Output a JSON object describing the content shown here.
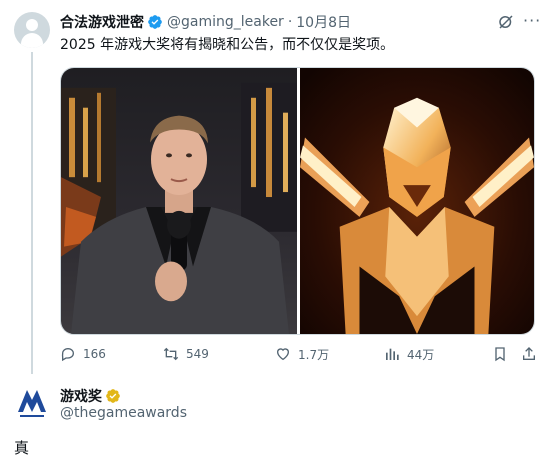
{
  "tweet": {
    "author_name": "合法游戏泄密",
    "handle": "@gaming_leaker",
    "separator": "·",
    "date": "10月8日",
    "text": "2025 年游戏大奖将有揭晓和公告，而不仅仅是奖项。",
    "verified_color": "#1d9bf0",
    "media": [
      {
        "icon": "host-with-microphone-photo"
      },
      {
        "icon": "golden-award-statue-photo"
      }
    ],
    "actions": {
      "replies": "166",
      "retweets": "549",
      "likes": "1.7万",
      "views": "44万"
    }
  },
  "reply": {
    "author_name": "游戏奖",
    "handle": "@thegameawards",
    "verified_color": "#e2b719",
    "text": "真"
  },
  "colors": {
    "text_primary": "#0f1419",
    "text_secondary": "#536471",
    "border": "#cfd9de",
    "logo_blue": "#1f4a9b"
  }
}
